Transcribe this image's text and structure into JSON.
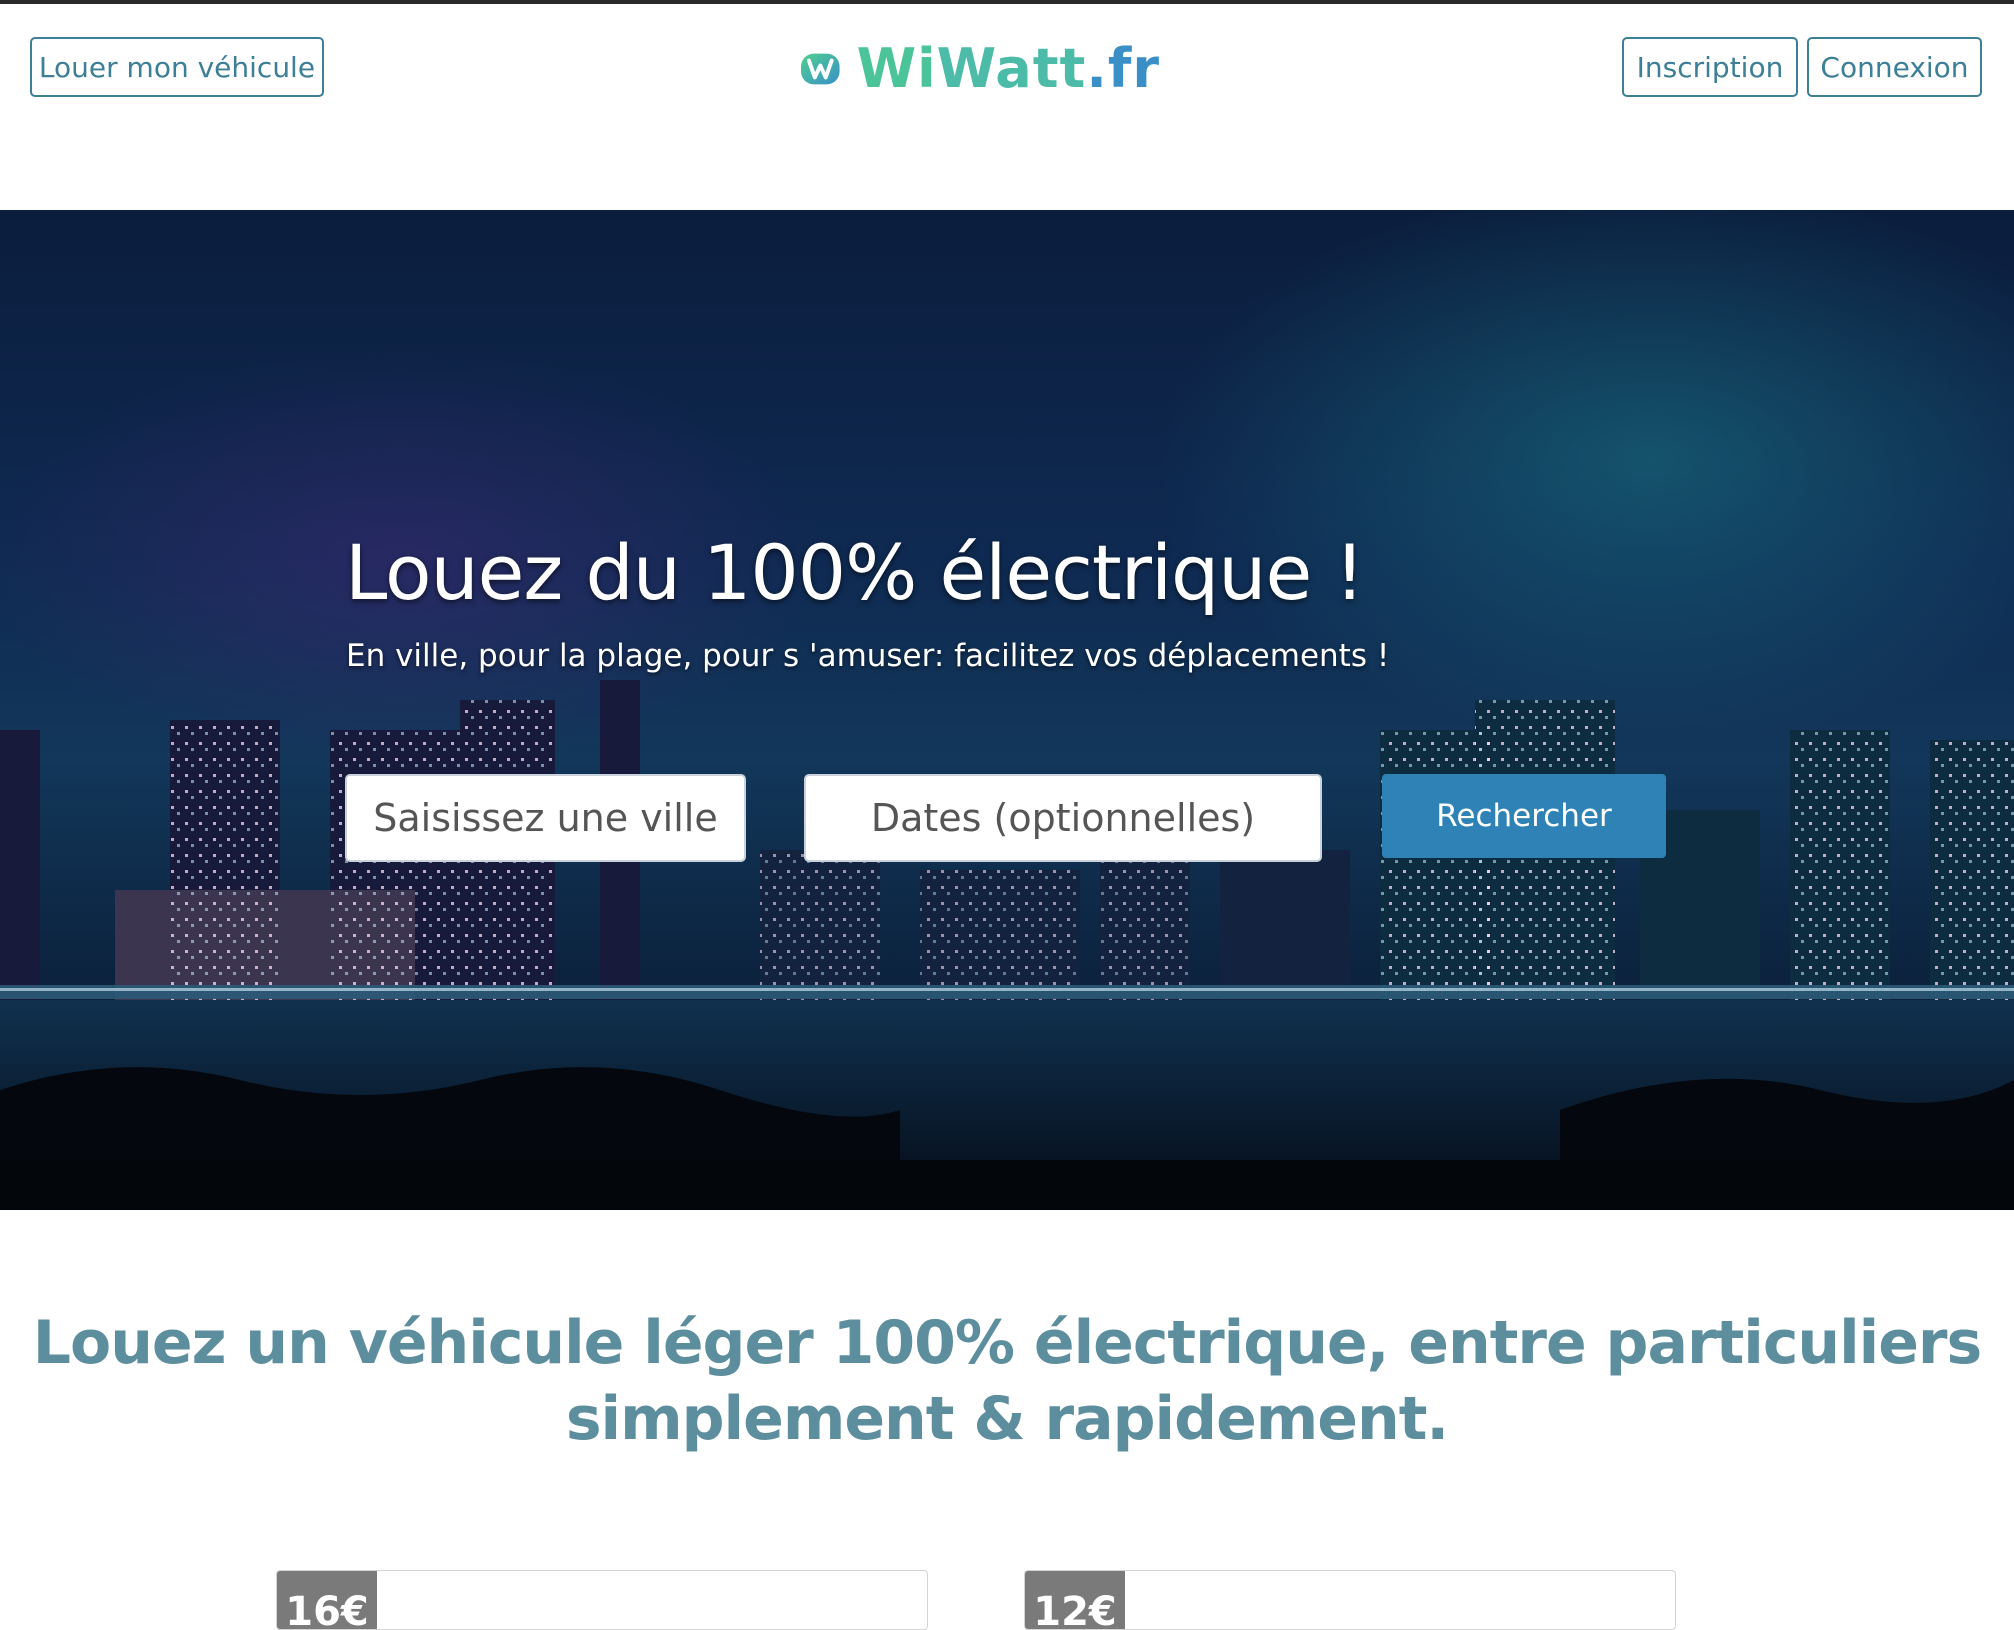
{
  "header": {
    "rent_out_label": "Louer mon véhicule",
    "signup_label": "Inscription",
    "login_label": "Connexion",
    "logo": {
      "part_wi": "Wi",
      "part_watt": "Watt",
      "part_fr": ".fr"
    }
  },
  "hero": {
    "title": "Louez du 100% électrique !",
    "subtitle": "En ville, pour la plage, pour s 'amuser: facilitez vos déplacements !",
    "city_placeholder": "Saisissez une ville",
    "dates_placeholder": "Dates (optionnelles)",
    "search_label": "Rechercher"
  },
  "tagline": {
    "line1": "Louez un véhicule léger 100% électrique, entre particuliers",
    "line2": "simplement & rapidement."
  },
  "cards": [
    {
      "price": "16€"
    },
    {
      "price": "12€"
    }
  ],
  "colors": {
    "accent": "#3d7f96",
    "search_button": "#2f82b5",
    "tagline": "#5d8e9e",
    "logo_green": "#4cc49a",
    "logo_blue": "#3a8fc7"
  }
}
